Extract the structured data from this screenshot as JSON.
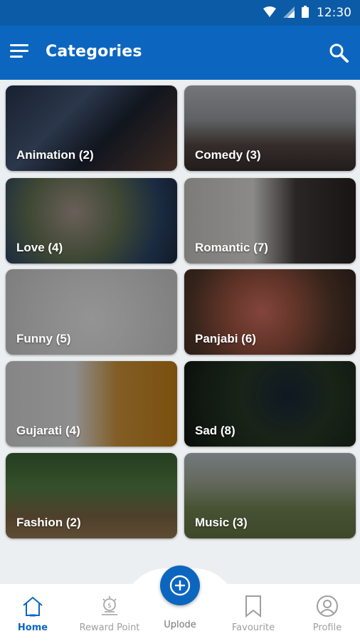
{
  "status": {
    "time": "12:30"
  },
  "appbar": {
    "title": "Categories"
  },
  "categories": [
    {
      "label": "Animation (2)"
    },
    {
      "label": "Comedy (3)"
    },
    {
      "label": "Love (4)"
    },
    {
      "label": "Romantic (7)"
    },
    {
      "label": "Funny (5)"
    },
    {
      "label": "Panjabi (6)"
    },
    {
      "label": "Gujarati (4)"
    },
    {
      "label": "Sad (8)"
    },
    {
      "label": "Fashion (2)"
    },
    {
      "label": "Music (3)"
    }
  ],
  "nav": {
    "home": "Home",
    "reward": "Reward Point",
    "upload": "Uplode",
    "favourite": "Favourite",
    "profile": "Profile"
  },
  "colors": {
    "primary": "#0c66c0",
    "statusbar": "#0b5ba7"
  }
}
